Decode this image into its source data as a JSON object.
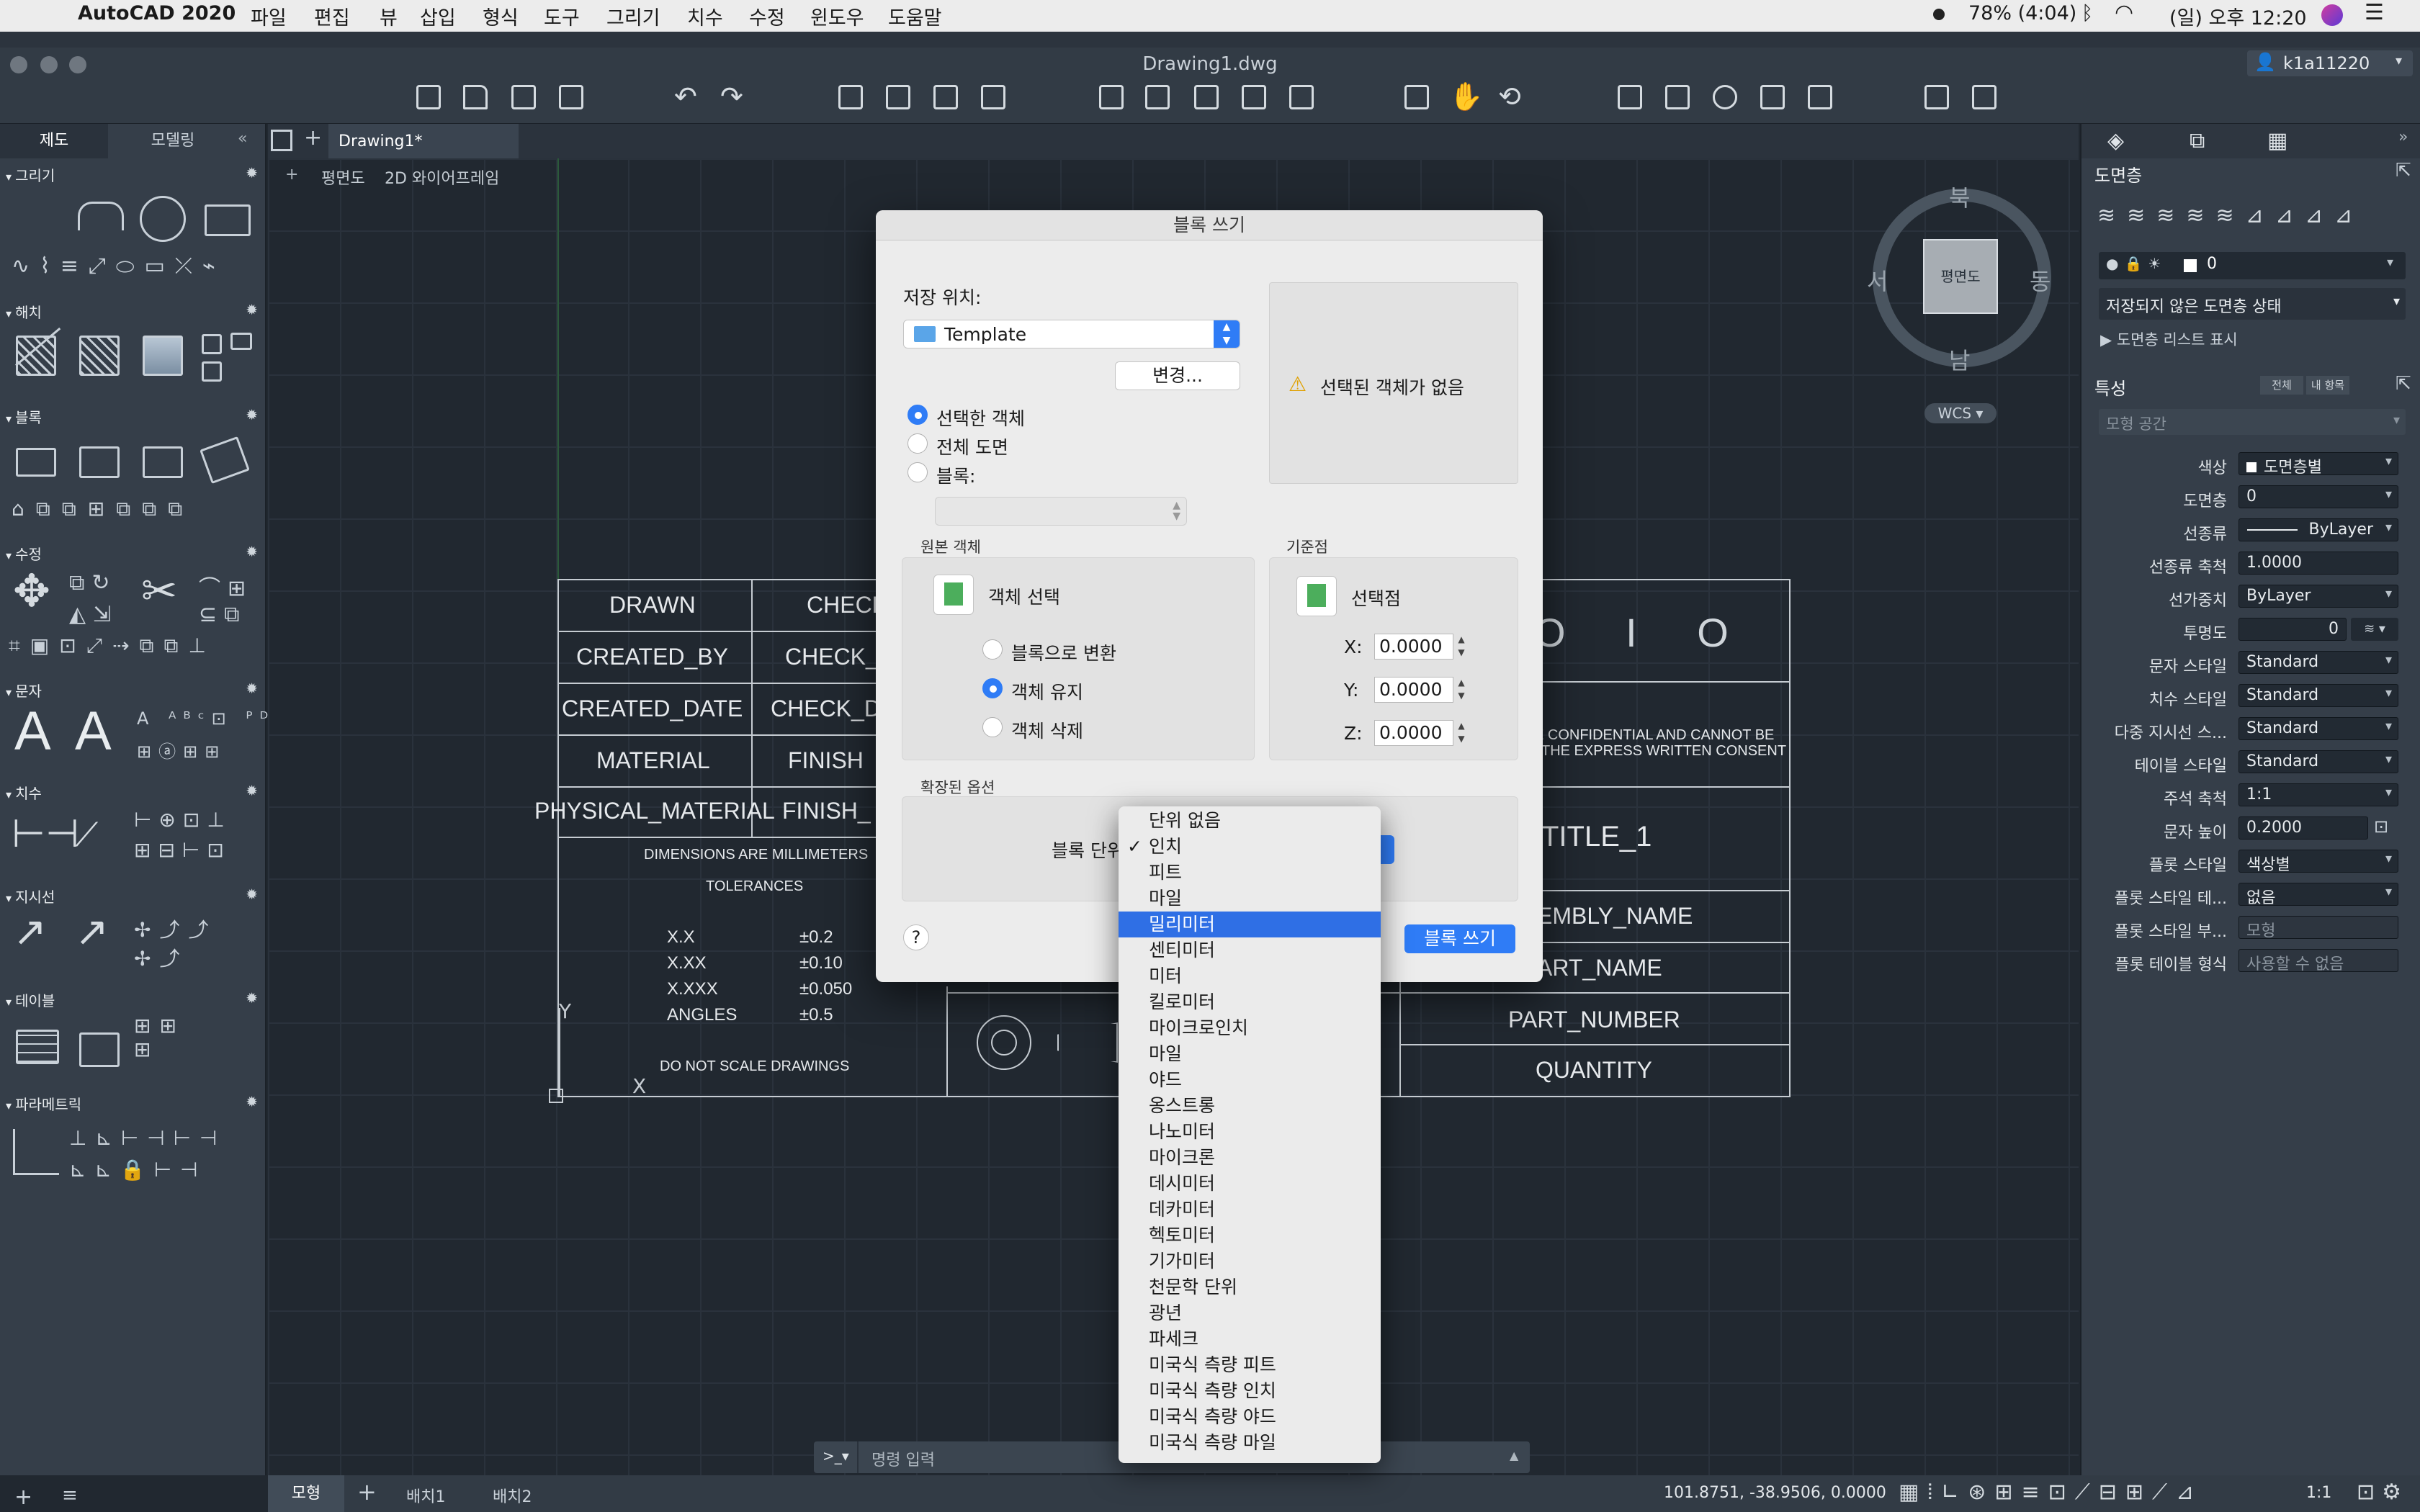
{
  "menubar": {
    "app": "AutoCAD 2020",
    "items": [
      "파일",
      "편집",
      "뷰",
      "삽입",
      "형식",
      "도구",
      "그리기",
      "치수",
      "수정",
      "윈도우",
      "도움말"
    ],
    "battery": "78% (4:04)",
    "clock": "(일) 오후 12:20"
  },
  "window": {
    "title": "Drawing1.dwg",
    "user": "k1a11220"
  },
  "left_panel": {
    "tabs": [
      "제도",
      "모델링"
    ],
    "sections": [
      "그리기",
      "해치",
      "블록",
      "수정",
      "문자",
      "치수",
      "지시선",
      "테이블",
      "파라메트릭"
    ]
  },
  "doc_tabs": {
    "active": "Drawing1*"
  },
  "viewport": {
    "label1": "평면도",
    "label2": "2D 와이어프레임"
  },
  "viewcube": {
    "north": "북",
    "south": "남",
    "west": "서",
    "east": "동",
    "face": "평면도",
    "wcs": "WCS"
  },
  "title_block": {
    "left_labels": [
      "DRAWN",
      "CREATED_BY",
      "CREATED_DATE",
      "MATERIAL",
      "PHYSICAL_MATERIAL"
    ],
    "mid_labels": [
      "CHECK",
      "CHECK_",
      "CHECK_D",
      "FINISH",
      "FINISH_"
    ],
    "dims": "DIMENSIONS ARE MILLIMETERS",
    "tolerances": "TOLERANCES",
    "tol_rows": [
      [
        "X.X",
        "±0.2"
      ],
      [
        "X.XX",
        "±0.10"
      ],
      [
        "X.XXX",
        "±0.050"
      ],
      [
        "ANGLES",
        "±0.5"
      ]
    ],
    "noscale": "DO NOT SCALE DRAWINGS",
    "logo": "O I O",
    "confidential1": "E CONFIDENTIAL AND CANNOT BE",
    "confidential2": "THE EXPRESS WRITTEN CONSENT",
    "right_cells": [
      "TITLE_1",
      "EMBLY_NAME",
      "ART_NAME",
      "PART_NUMBER",
      "QUANTITY"
    ]
  },
  "dialog": {
    "title": "블록 쓰기",
    "save_location_label": "저장 위치:",
    "folder": "Template",
    "change_btn": "변경...",
    "no_selection": "선택된 객체가 없음",
    "radios": [
      "선택한 객체",
      "전체 도면",
      "블록:"
    ],
    "source_group": "원본 객체",
    "select_objects": "객체 선택",
    "source_opts": [
      "블록으로 변환",
      "객체 유지",
      "객체 삭제"
    ],
    "base_group": "기준점",
    "pick_point": "선택점",
    "x_label": "X:",
    "y_label": "Y:",
    "z_label": "Z:",
    "x": "0.0000",
    "y": "0.0000",
    "z": "0.0000",
    "ext_group": "확장된 옵션",
    "units_label": "블록 단위",
    "help": "?",
    "ok": "블록 쓰기"
  },
  "units_menu": {
    "checked": "인치",
    "selected": "밀리미터",
    "options": [
      "단위 없음",
      "인치",
      "피트",
      "마일",
      "밀리미터",
      "센티미터",
      "미터",
      "킬로미터",
      "마이크로인치",
      "마일",
      "야드",
      "옹스트롱",
      "나노미터",
      "마이크론",
      "데시미터",
      "데카미터",
      "헥토미터",
      "기가미터",
      "천문학 단위",
      "광년",
      "파세크",
      "미국식 측량 피트",
      "미국식 측량 인치",
      "미국식 측량 야드",
      "미국식 측량 마일"
    ]
  },
  "right_panel": {
    "layers_title": "도면층",
    "layer_name": "0",
    "layer_state": "저장되지 않은 도면층 상태",
    "layer_list": "도면층 리스트 표시",
    "props_title": "특성",
    "btn_all": "전체",
    "btn_mine": "내 항목",
    "model_space": "모형 공간",
    "props": [
      [
        "색상",
        "도면층별"
      ],
      [
        "도면층",
        "0"
      ],
      [
        "선종류",
        "ByLayer"
      ],
      [
        "선종류 축척",
        "1.0000"
      ],
      [
        "선가중치",
        "ByLayer"
      ],
      [
        "투명도",
        "0"
      ],
      [
        "문자 스타일",
        "Standard"
      ],
      [
        "치수 스타일",
        "Standard"
      ],
      [
        "다중 지시선 스...",
        "Standard"
      ],
      [
        "테이블 스타일",
        "Standard"
      ],
      [
        "주석 축척",
        "1:1"
      ],
      [
        "문자 높이",
        "0.2000"
      ],
      [
        "플롯 스타일",
        "색상별"
      ],
      [
        "플롯 스타일 테...",
        "없음"
      ],
      [
        "플롯 스타일 부...",
        "모형"
      ],
      [
        "플롯 테이블 형식",
        "사용할 수 없음"
      ]
    ]
  },
  "command": {
    "prompt": ">_▾",
    "placeholder": "명령 입력"
  },
  "status": {
    "tabs": [
      "모형",
      "배치1",
      "배치2"
    ],
    "coords": "101.8751, -38.9506, 0.0000",
    "scale": "1:1"
  }
}
